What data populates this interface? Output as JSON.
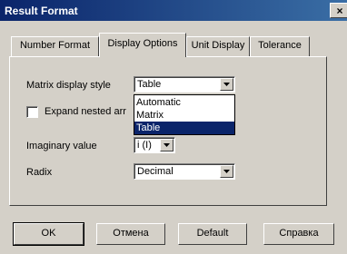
{
  "window": {
    "title": "Result Format",
    "close_glyph": "×"
  },
  "tabs": [
    {
      "label": "Number Format",
      "active": false
    },
    {
      "label": "Display Options",
      "active": true
    },
    {
      "label": "Unit Display",
      "active": false
    },
    {
      "label": "Tolerance",
      "active": false
    }
  ],
  "display_options": {
    "matrix_style": {
      "label": "Matrix display style",
      "value": "Table",
      "options": [
        "Automatic",
        "Matrix",
        "Table"
      ],
      "selected_index": 2
    },
    "expand_nested": {
      "label": "Expand nested arr",
      "checked": false
    },
    "imaginary": {
      "label": "Imaginary value",
      "value": "i (I)"
    },
    "radix": {
      "label": "Radix",
      "value": "Decimal"
    }
  },
  "buttons": {
    "ok": "OK",
    "cancel": "Отмена",
    "default": "Default",
    "help": "Справка"
  }
}
